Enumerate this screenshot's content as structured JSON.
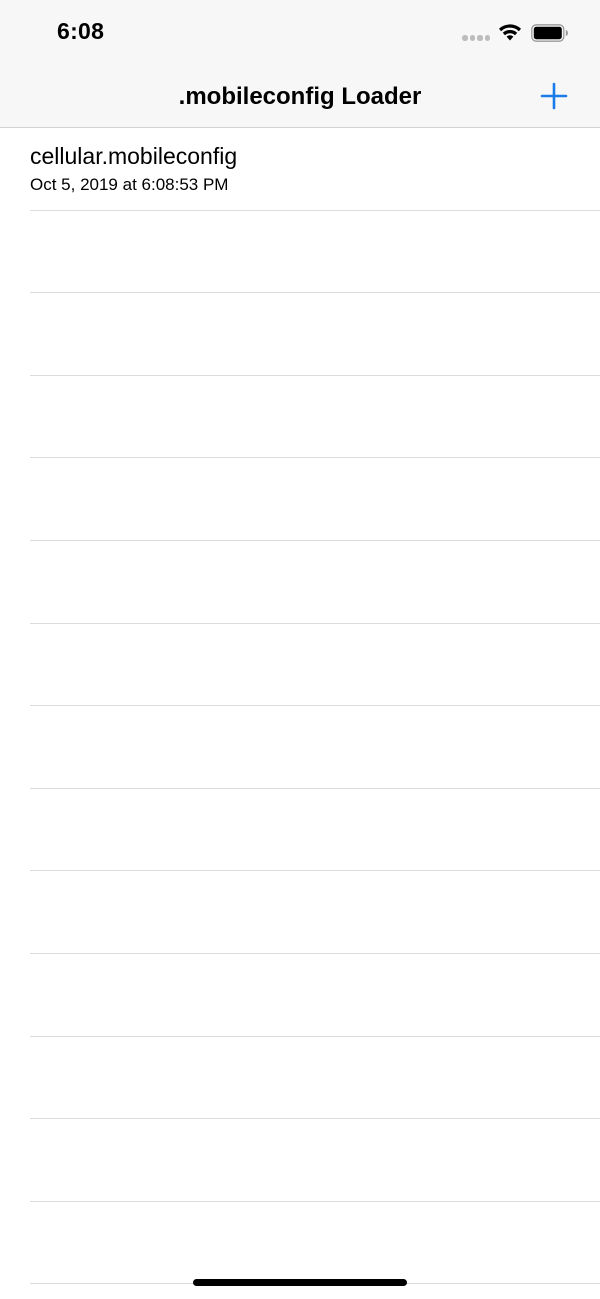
{
  "status_bar": {
    "time": "6:08",
    "signal_icon": "cellular-signal-dots",
    "wifi_icon": "wifi-icon",
    "battery_icon": "battery-icon"
  },
  "nav_bar": {
    "title": ".mobileconfig Loader",
    "add_icon": "plus-icon",
    "accent_color": "#1a7ce8"
  },
  "list": {
    "items": [
      {
        "title": "cellular.mobileconfig",
        "subtitle": "Oct 5, 2019 at 6:08:53 PM"
      }
    ],
    "empty_rows": 13
  }
}
